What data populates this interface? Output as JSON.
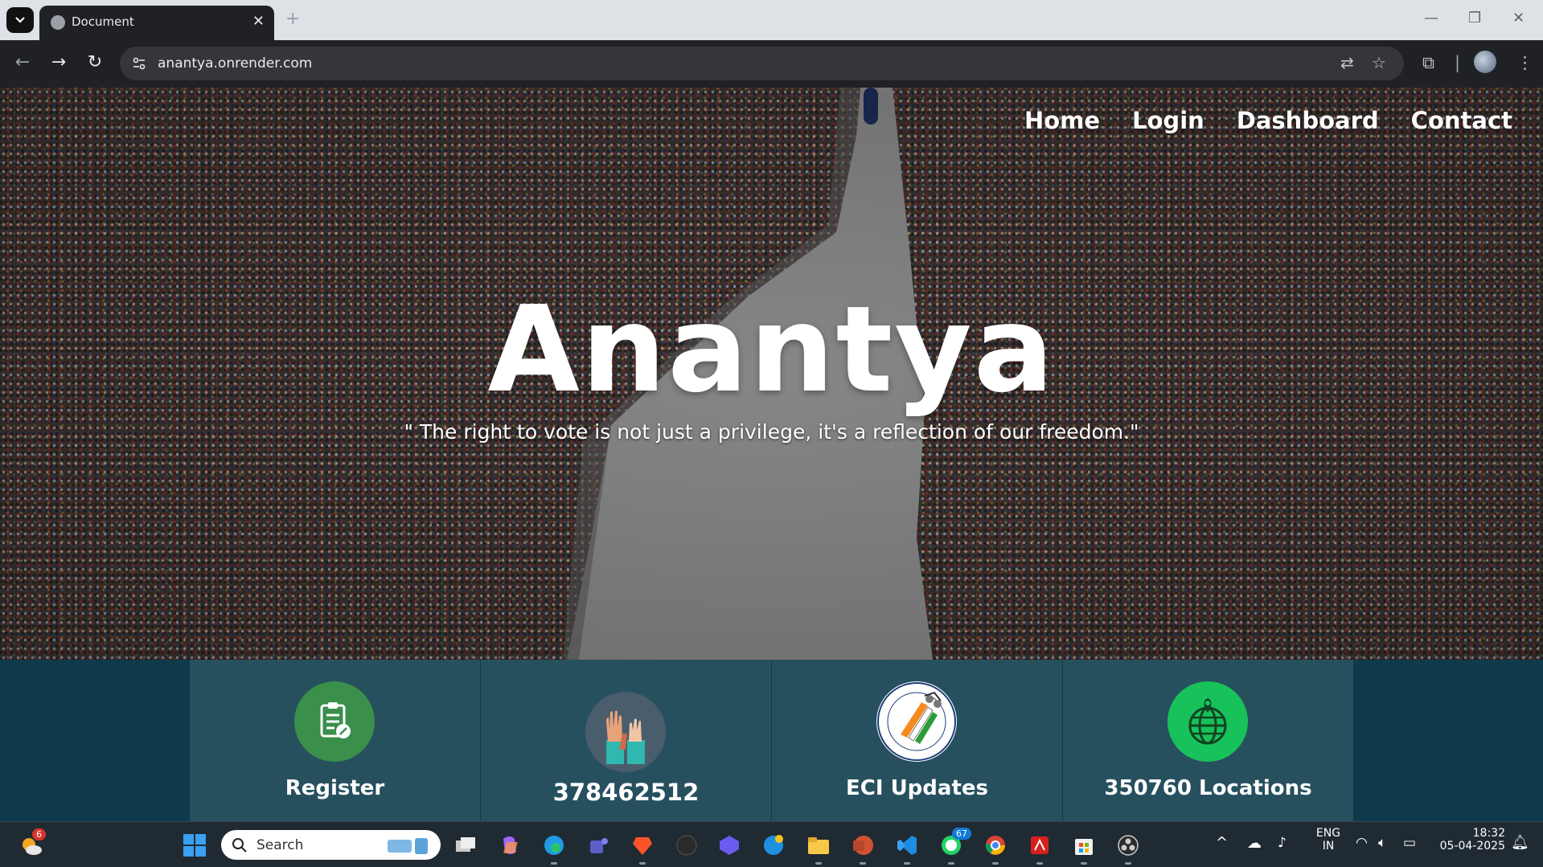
{
  "browser": {
    "tab_title": "Document",
    "url": "anantya.onrender.com"
  },
  "site": {
    "nav": [
      "Home",
      "Login",
      "Dashboard",
      "Contact"
    ],
    "title": "Anantya",
    "quote": "\" The right to vote is not just a privilege, it's a reflection of our freedom.\"",
    "cards": [
      {
        "label": "Register",
        "icon": "clipboard-icon",
        "color": "#3a8f4a"
      },
      {
        "label": "378462512",
        "icon": "raised-hands-icon",
        "color": "#4a5d6c"
      },
      {
        "label": "ECI Updates",
        "icon": "eci-logo-icon",
        "color": "#ffffff"
      },
      {
        "label": "350760 Locations",
        "icon": "globe-icon",
        "color": "#18c25a"
      }
    ]
  },
  "taskbar": {
    "search_placeholder": "Search",
    "weather_badge": "6",
    "whatsapp_badge": "67",
    "lang_line1": "ENG",
    "lang_line2": "IN",
    "time": "18:32",
    "date": "05-04-2025"
  }
}
